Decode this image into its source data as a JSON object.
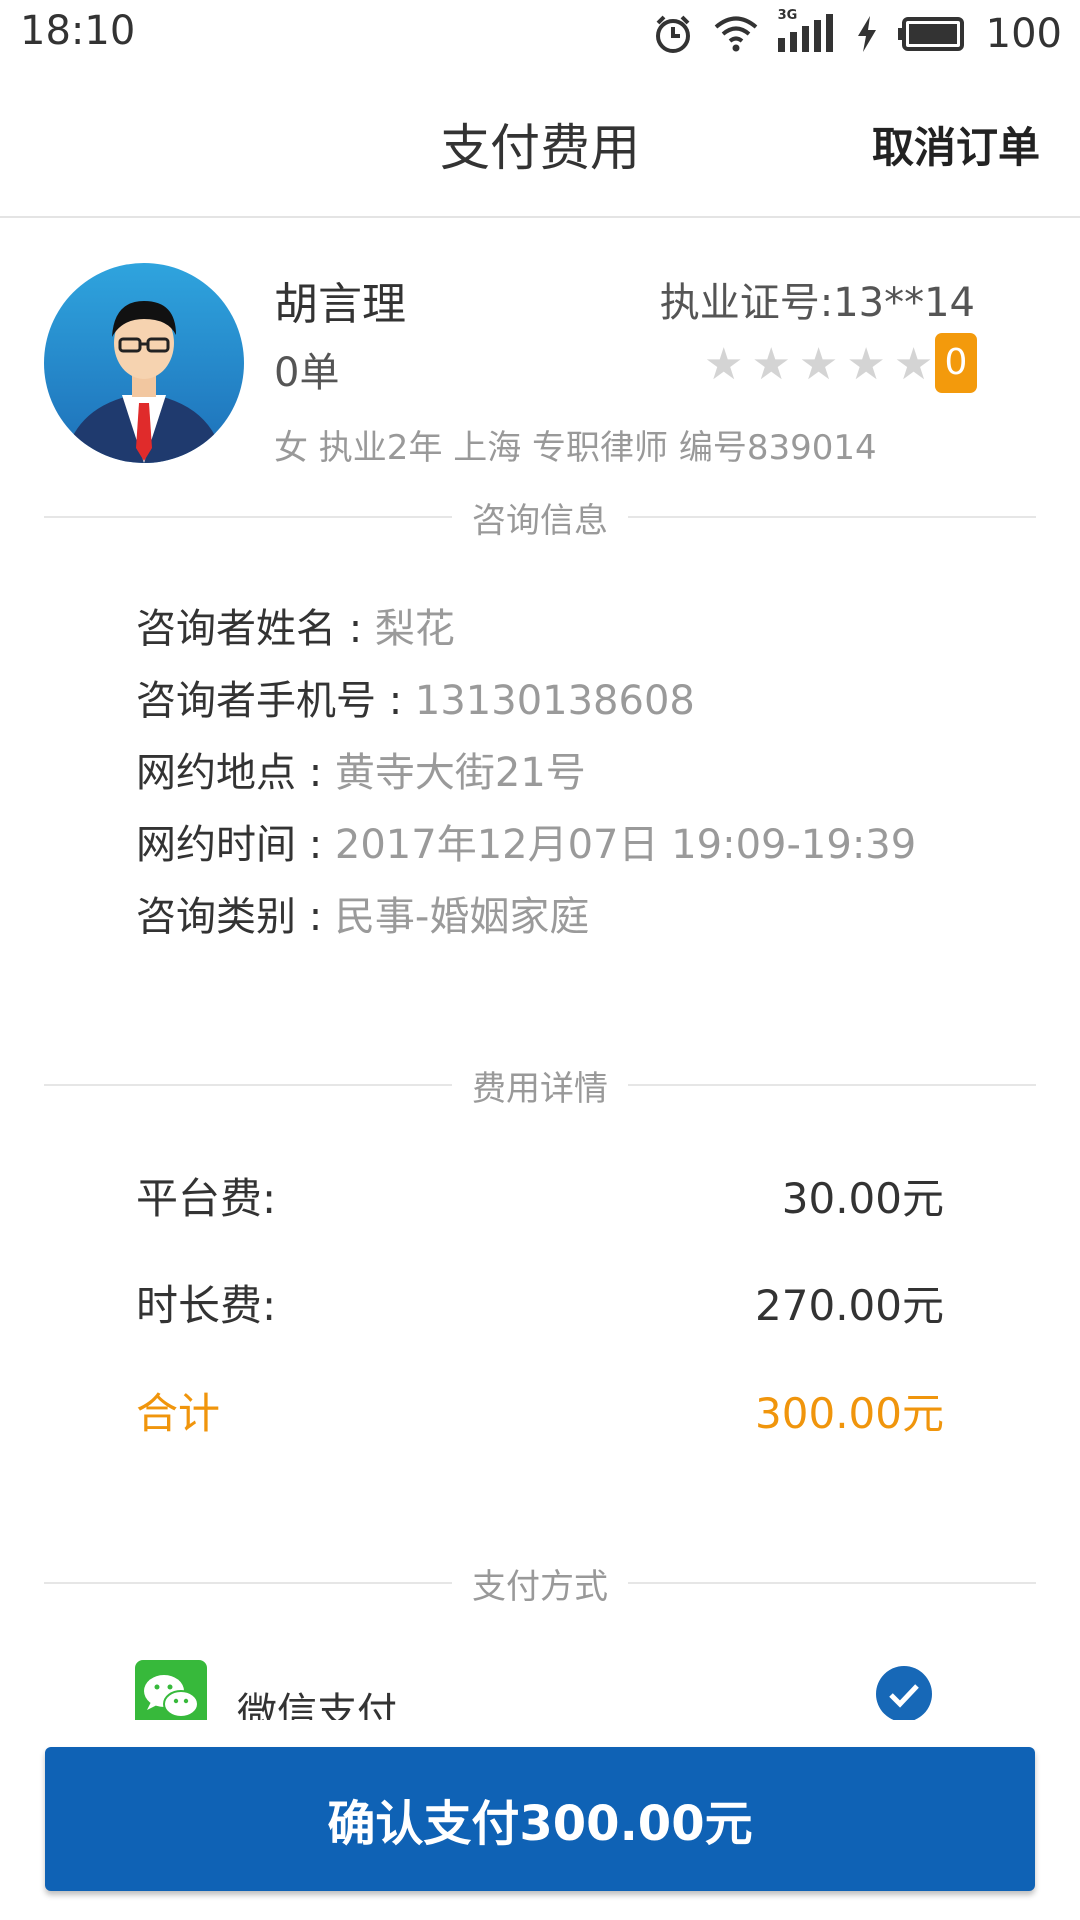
{
  "status_bar": {
    "time": "18:10",
    "network_label": "3G",
    "battery": "100",
    "icons": [
      "alarm-icon",
      "wifi-icon",
      "signal-3g-icon",
      "charging-icon",
      "battery-icon"
    ]
  },
  "header": {
    "title": "支付费用",
    "cancel_label": "取消订单"
  },
  "lawyer": {
    "name": "胡言理",
    "license": "执业证号:13**14",
    "order_count": "0单",
    "rating_stars": 0,
    "rating_badge": "0",
    "info": "女 执业2年 上海 专职律师 编号839014"
  },
  "consult": {
    "section_title": "咨询信息",
    "rows": [
      {
        "label": "咨询者姓名 : ",
        "value": "梨花"
      },
      {
        "label": "咨询者手机号 : ",
        "value": "13130138608"
      },
      {
        "label": "网约地点 : ",
        "value": "黄寺大街21号"
      },
      {
        "label": "网约时间 : ",
        "value": "2017年12月07日 19:09-19:39"
      },
      {
        "label": "咨询类别 : ",
        "value": "民事-婚姻家庭"
      }
    ]
  },
  "fees": {
    "section_title": "费用详情",
    "platform_label": "平台费:",
    "platform_value": "30.00元",
    "duration_label": "时长费:",
    "duration_value": "270.00元",
    "total_label": "合计",
    "total_value": "300.00元"
  },
  "payment": {
    "section_title": "支付方式",
    "method_label": "微信支付",
    "selected": true
  },
  "confirm_label": "确认支付300.00元",
  "colors": {
    "accent_blue": "#0f62b5",
    "orange": "#f0950c",
    "wechat_green": "#37b93b"
  }
}
